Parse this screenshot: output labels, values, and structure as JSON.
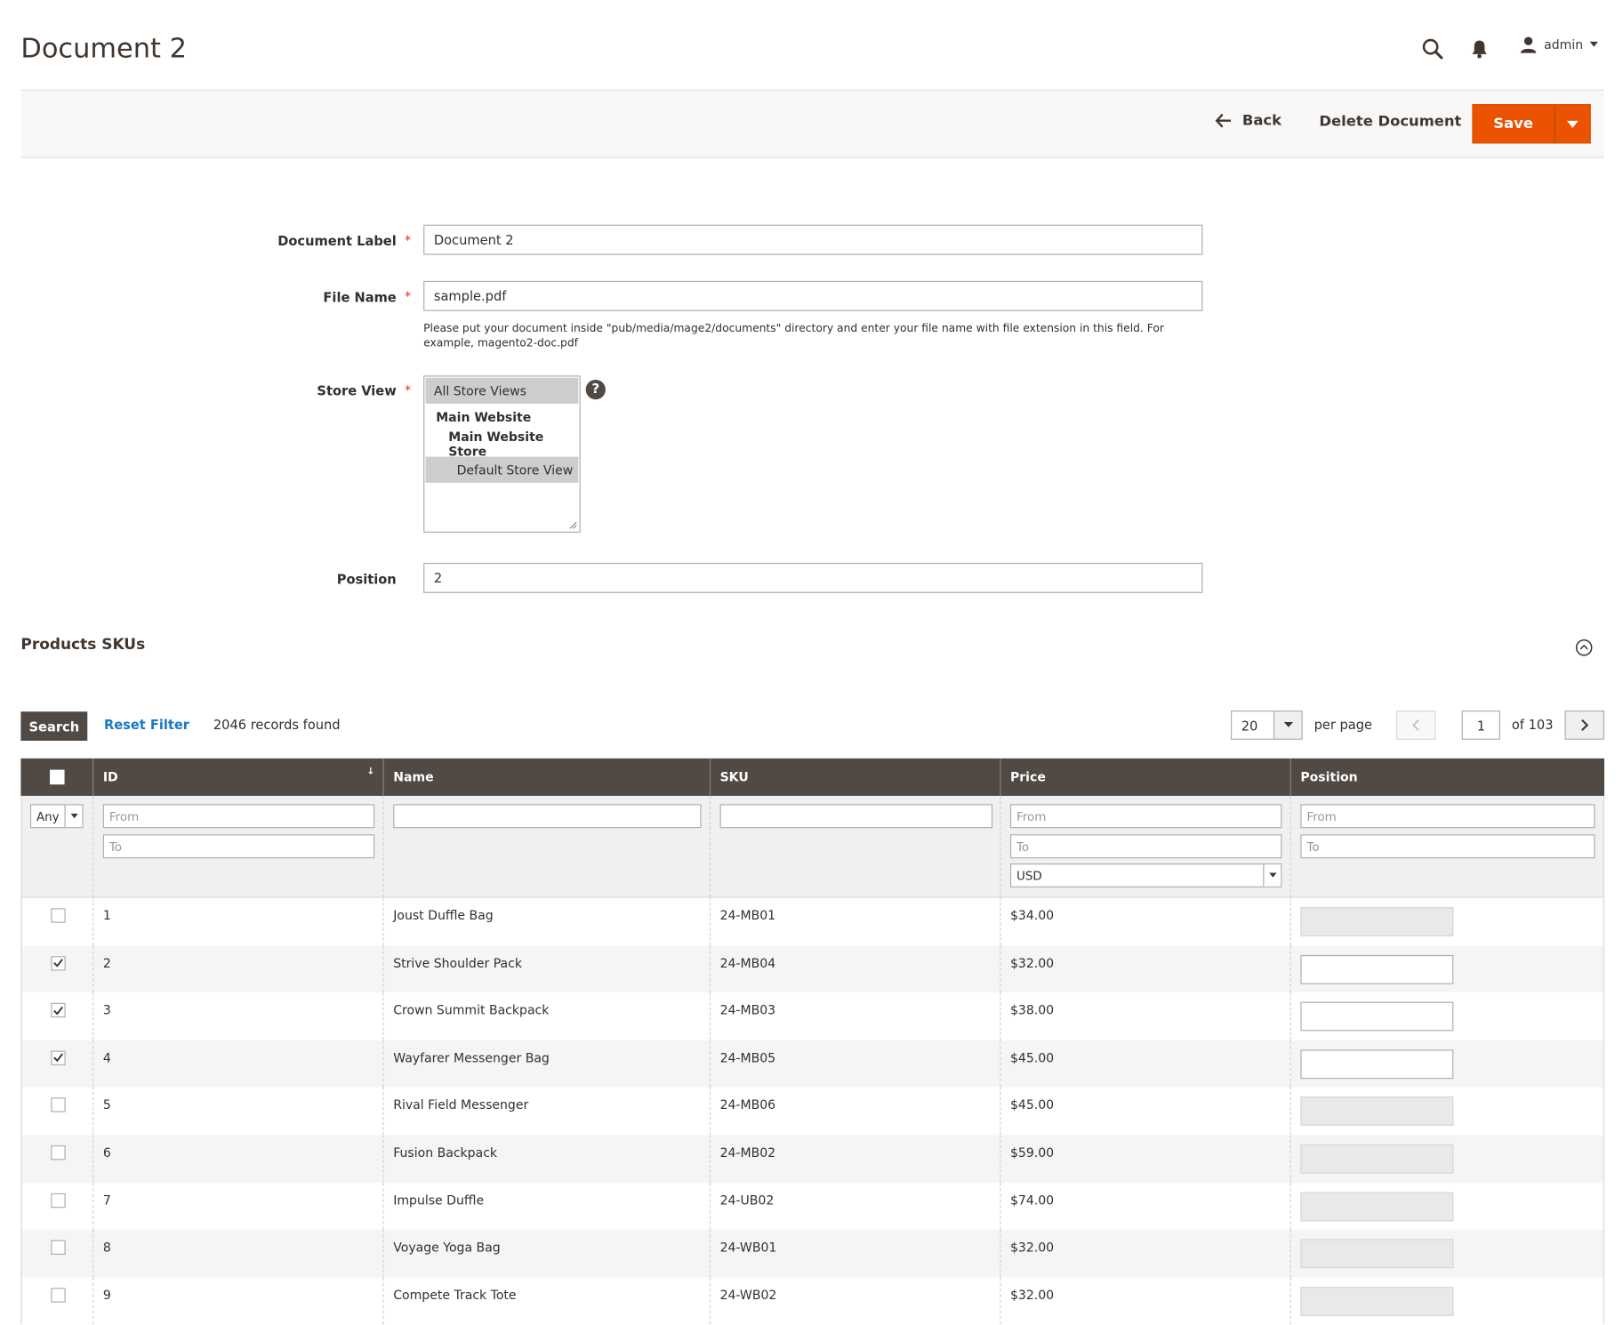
{
  "header": {
    "title": "Document 2",
    "user": "admin"
  },
  "actions": {
    "back": "Back",
    "delete": "Delete Document",
    "save": "Save"
  },
  "form": {
    "label_field": {
      "label": "Document Label",
      "value": "Document 2"
    },
    "file_field": {
      "label": "File Name",
      "value": "sample.pdf",
      "note": "Please put your document inside \"pub/media/mage2/documents\" directory and enter your file name with file extension in this field. For example, magento2-doc.pdf"
    },
    "store_field": {
      "label": "Store View",
      "options": [
        "All Store Views",
        "Main Website",
        "Main Website Store",
        "Default Store View"
      ]
    },
    "position_field": {
      "label": "Position",
      "value": "2"
    }
  },
  "section": {
    "title": "Products SKUs"
  },
  "grid": {
    "search_label": "Search",
    "reset_label": "Reset Filter",
    "records": "2046 records found",
    "per_page_value": "20",
    "per_page_label": "per page",
    "page_value": "1",
    "page_total": "of 103",
    "columns": [
      "ID",
      "Name",
      "SKU",
      "Price",
      "Position"
    ],
    "filters": {
      "any": "Any",
      "from": "From",
      "to": "To",
      "currency": "USD"
    },
    "rows": [
      {
        "checked": false,
        "id": "1",
        "name": "Joust Duffle Bag",
        "sku": "24-MB01",
        "price": "$34.00"
      },
      {
        "checked": true,
        "id": "2",
        "name": "Strive Shoulder Pack",
        "sku": "24-MB04",
        "price": "$32.00"
      },
      {
        "checked": true,
        "id": "3",
        "name": "Crown Summit Backpack",
        "sku": "24-MB03",
        "price": "$38.00"
      },
      {
        "checked": true,
        "id": "4",
        "name": "Wayfarer Messenger Bag",
        "sku": "24-MB05",
        "price": "$45.00"
      },
      {
        "checked": false,
        "id": "5",
        "name": "Rival Field Messenger",
        "sku": "24-MB06",
        "price": "$45.00"
      },
      {
        "checked": false,
        "id": "6",
        "name": "Fusion Backpack",
        "sku": "24-MB02",
        "price": "$59.00"
      },
      {
        "checked": false,
        "id": "7",
        "name": "Impulse Duffle",
        "sku": "24-UB02",
        "price": "$74.00"
      },
      {
        "checked": false,
        "id": "8",
        "name": "Voyage Yoga Bag",
        "sku": "24-WB01",
        "price": "$32.00"
      },
      {
        "checked": false,
        "id": "9",
        "name": "Compete Track Tote",
        "sku": "24-WB02",
        "price": "$32.00"
      }
    ]
  },
  "colors": {
    "accent": "#eb5202",
    "header_dark": "#514943",
    "link": "#1979c3"
  },
  "icons": [
    "search-icon",
    "bell-icon",
    "user-icon",
    "arrow-left-icon",
    "chevron-down-icon",
    "help-icon",
    "collapse-icon",
    "chevron-left-icon",
    "chevron-right-icon",
    "sort-icon",
    "check-icon"
  ]
}
